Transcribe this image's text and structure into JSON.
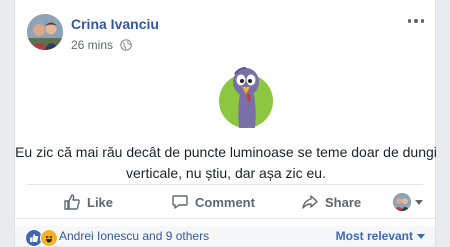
{
  "post": {
    "author": "Crina Ivanciu",
    "time": "26 mins",
    "privacy_icon": "globe-icon",
    "text": "Eu zic că mai rău decât de puncte luminoase se teme doar de dungi verticale, nu știu, dar așa zic eu."
  },
  "actions": {
    "like": "Like",
    "comment": "Comment",
    "share": "Share"
  },
  "reactions": {
    "summary": "Andrei Ionescu and 9 others",
    "sort": "Most relevant"
  },
  "colors": {
    "link": "#365899",
    "accent": "#4267b2",
    "sticker_bg": "#8dc63f",
    "turkey_body": "#7b6fa8"
  }
}
